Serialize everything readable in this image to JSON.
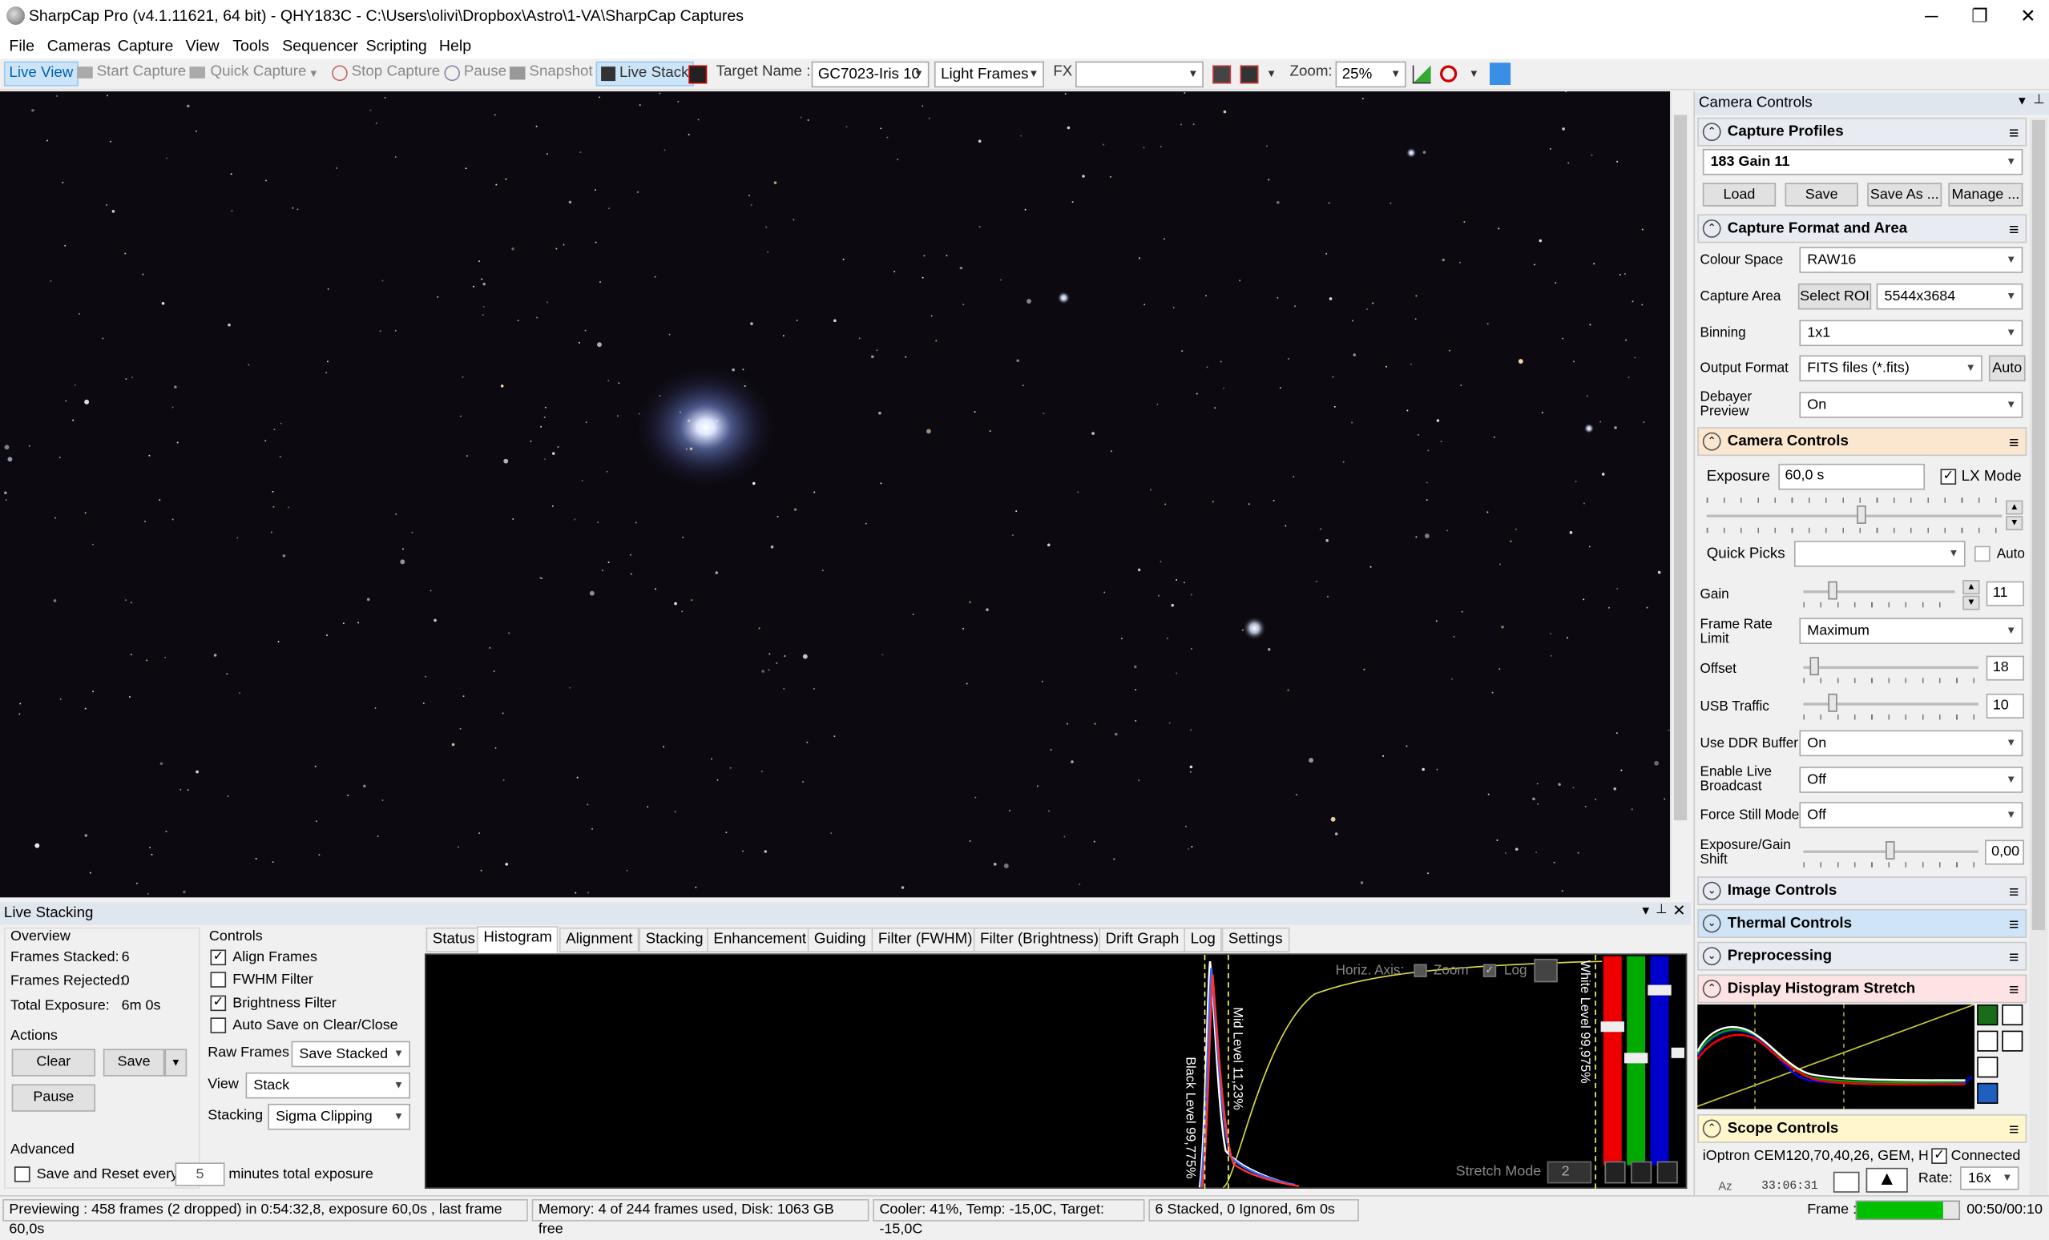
{
  "window": {
    "title": "SharpCap Pro (v4.1.11621, 64 bit) - QHY183C - C:\\Users\\olivi\\Dropbox\\Astro\\1-VA\\SharpCap Captures",
    "minimize": "─",
    "restore": "❐",
    "close": "✕"
  },
  "menu": [
    "File",
    "Cameras",
    "Capture",
    "View",
    "Tools",
    "Sequencer",
    "Scripting",
    "Help"
  ],
  "toolbar": {
    "live_view": "Live View",
    "start_capture": "Start Capture",
    "quick_capture": "Quick Capture",
    "stop_capture": "Stop Capture",
    "pause": "Pause",
    "snapshot": "Snapshot",
    "live_stack": "Live Stack",
    "target_name_label": "Target Name :",
    "target_name_value": "GC7023-Iris 10",
    "frame_type": "Light Frames",
    "fx_label": "FX",
    "fx_value": "",
    "zoom_label": "Zoom:",
    "zoom_value": "25%"
  },
  "right_panel": {
    "header": "Camera Controls",
    "capture_profiles": {
      "title": "Capture Profiles",
      "profile": "183 Gain 11",
      "load": "Load",
      "save": "Save",
      "save_as": "Save As ...",
      "manage": "Manage ..."
    },
    "capture_format": {
      "title": "Capture Format and Area",
      "colour_space_label": "Colour Space",
      "colour_space": "RAW16",
      "capture_area_label": "Capture Area",
      "select_roi": "Select ROI",
      "capture_area": "5544x3684",
      "binning_label": "Binning",
      "binning": "1x1",
      "output_format_label": "Output Format",
      "output_format": "FITS files (*.fits)",
      "auto": "Auto",
      "debayer_label_1": "Debayer",
      "debayer_label_2": "Preview",
      "debayer": "On"
    },
    "camera_controls": {
      "title": "Camera Controls",
      "exposure_label": "Exposure",
      "exposure": "60,0 s",
      "lx_mode": "LX Mode",
      "quick_picks_label": "Quick Picks",
      "quick_picks_auto": "Auto",
      "gain_label": "Gain",
      "gain": "11",
      "frame_rate_label_1": "Frame Rate",
      "frame_rate_label_2": "Limit",
      "frame_rate": "Maximum",
      "offset_label": "Offset",
      "offset": "18",
      "usb_label": "USB Traffic",
      "usb": "10",
      "ddr_label": "Use DDR Buffer",
      "ddr": "On",
      "broadcast_label_1": "Enable Live",
      "broadcast_label_2": "Broadcast",
      "broadcast": "Off",
      "still_label": "Force Still Mode",
      "still": "Off",
      "shift_label_1": "Exposure/Gain",
      "shift_label_2": "Shift",
      "shift": "0,00"
    },
    "image_controls": "Image Controls",
    "thermal_controls": "Thermal Controls",
    "preprocessing": "Preprocessing",
    "histogram_stretch": "Display Histogram Stretch",
    "scope": {
      "title": "Scope Controls",
      "mount": "iOptron CEM120,70,40,26, GEM, H",
      "connected": "Connected",
      "coord": "33:06:31",
      "az": "Az",
      "rate_label": "Rate:",
      "rate": "16x"
    }
  },
  "live_stacking": {
    "header": "Live Stacking",
    "overview": {
      "title": "Overview",
      "frames_stacked_label": "Frames Stacked:",
      "frames_stacked": "6",
      "frames_rejected_label": "Frames Rejected:",
      "frames_rejected": "0",
      "total_exposure_label": "Total Exposure:",
      "total_exposure": "6m 0s"
    },
    "actions": {
      "title": "Actions",
      "clear": "Clear",
      "save": "Save",
      "pause": "Pause"
    },
    "advanced": {
      "title": "Advanced",
      "save_reset_label": "Save and Reset every",
      "minutes": "5",
      "minutes_suffix": "minutes total exposure"
    },
    "controls": {
      "title": "Controls",
      "align": "Align Frames",
      "fwhm": "FWHM Filter",
      "brightness": "Brightness Filter",
      "autosave": "Auto Save on Clear/Close",
      "raw_frames_label": "Raw Frames",
      "raw_frames": "Save Stacked",
      "view_label": "View",
      "view": "Stack",
      "stacking_label": "Stacking",
      "stacking": "Sigma Clipping"
    },
    "tabs": [
      "Status",
      "Histogram",
      "Alignment",
      "Stacking",
      "Enhancement",
      "Guiding",
      "Filter (FWHM)",
      "Filter (Brightness)",
      "Drift Graph",
      "Log",
      "Settings"
    ],
    "histogram": {
      "horiz_axis": "Horiz. Axis:",
      "zoom": "Zoom",
      "log": "Log",
      "black_level": "Black Level 99,775%",
      "mid_level": "Mid Level 11,23%",
      "white_level": "White Level 99,975%",
      "stretch_mode_label": "Stretch Mode",
      "stretch_mode": "2"
    }
  },
  "status": {
    "preview": "Previewing : 458 frames (2 dropped) in 0:54:32,8, exposure 60,0s , last frame 60,0s",
    "memory": "Memory: 4 of 244 frames used, Disk: 1063 GB free",
    "cooler": "Cooler: 41%, Temp: -15,0C, Target: -15,0C",
    "stack": "6 Stacked, 0 Ignored, 6m 0s",
    "frame_label": "Frame :",
    "time": "00:50/00:10"
  },
  "colors": {
    "accent": "#0078d7",
    "frame_progress": "#00c000",
    "thermal": "#cfe4f7",
    "histogram_stretch": "#fde3e3",
    "sky": "#0c0a10"
  }
}
